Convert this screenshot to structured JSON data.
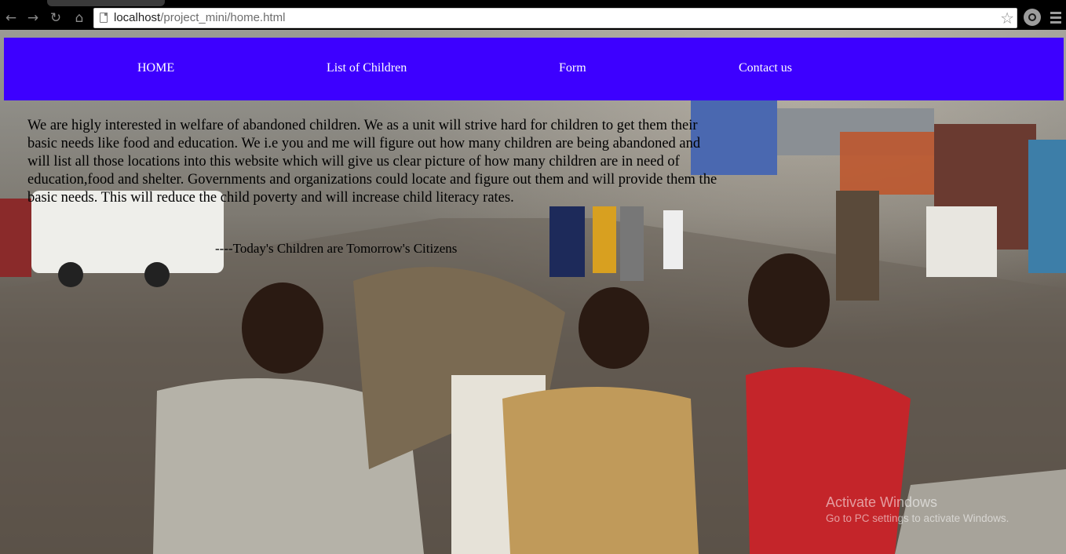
{
  "browser": {
    "url_host": "localhost",
    "url_path": "/project_mini/home.html",
    "icons": [
      "back-icon",
      "forward-icon",
      "reload-icon",
      "home-icon",
      "page-icon",
      "star-icon",
      "extension-icon",
      "menu-icon"
    ]
  },
  "navbar": {
    "items": [
      {
        "label": "HOME"
      },
      {
        "label": "List of Children"
      },
      {
        "label": "Form"
      },
      {
        "label": "Contact us"
      }
    ],
    "background_color": "#3d00ff",
    "text_color": "#ffffff"
  },
  "main": {
    "intro": "We are higly interested in welfare of abandoned children. We as a unit will strive hard for children to get them their basic needs like food and education. We i.e you and me will figure out how many children are being abandoned and will list all those locations into this website which will give us clear picture of how many children are in need of education,food and shelter. Governments and organizations could locate and figure out them and will provide them the basic needs. This will reduce the child poverty and will increase child literacy rates.",
    "tagline": "----Today's Children are Tomorrow's Citizens"
  },
  "watermark": {
    "title": "Activate Windows",
    "subtitle": "Go to PC settings to activate Windows."
  }
}
